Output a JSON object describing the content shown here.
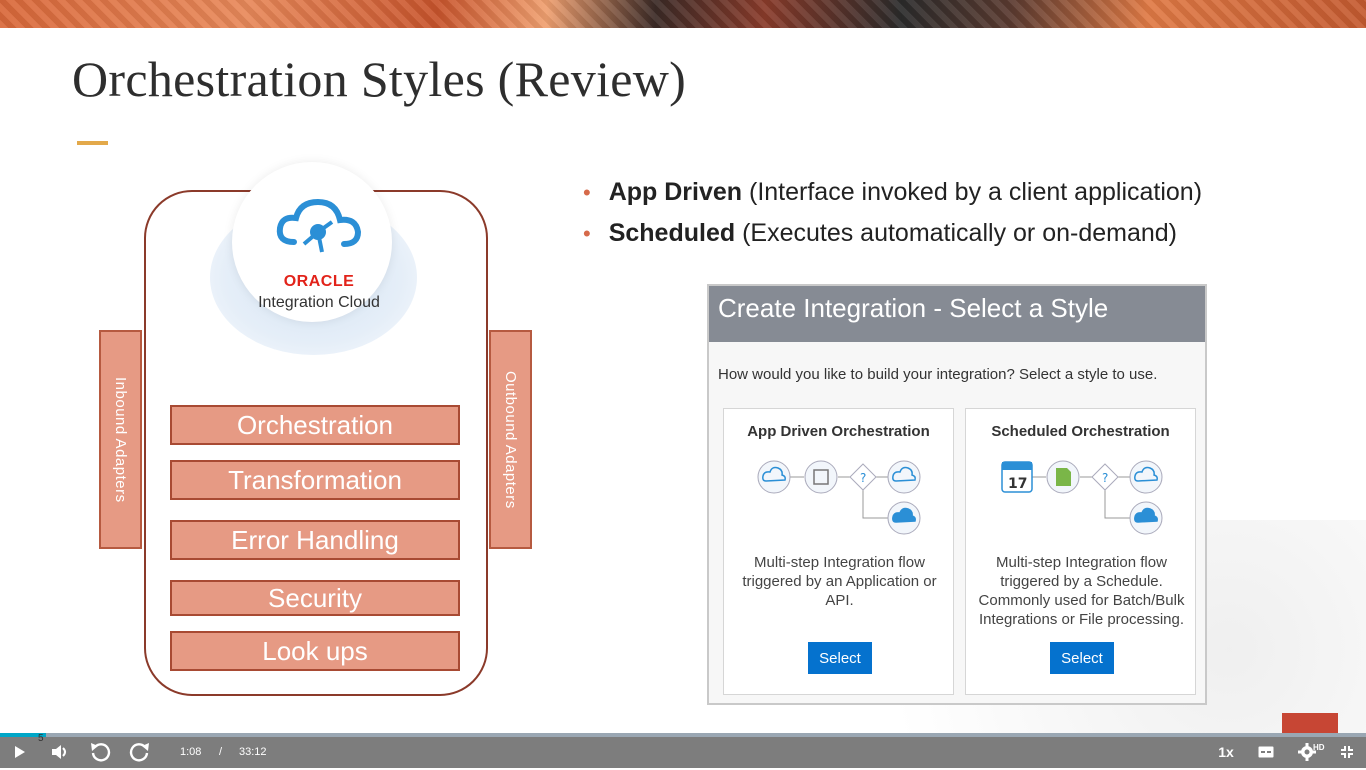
{
  "slide": {
    "title": "Orchestration Styles (Review)",
    "page_number": "5"
  },
  "diagram": {
    "brand": "ORACLE",
    "product": "Integration Cloud",
    "inbound_label": "Inbound Adapters",
    "outbound_label": "Outbound Adapters",
    "capabilities": [
      "Orchestration",
      "Transformation",
      "Error Handling",
      "Security",
      "Look ups"
    ]
  },
  "bullets": [
    {
      "bold": "App Driven",
      "text": " (Interface invoked by a client application)"
    },
    {
      "bold": "Scheduled",
      "text": " (Executes automatically or on-demand)"
    }
  ],
  "dialog": {
    "title": "Create Integration - Select a Style",
    "question": "How would you like to build your integration? Select a style to use.",
    "cards": [
      {
        "title": "App Driven Orchestration",
        "description": "Multi-step Integration flow triggered by an Application or API.",
        "button": "Select"
      },
      {
        "title": "Scheduled Orchestration",
        "description": "Multi-step Integration flow triggered by a Schedule. Commonly used for Batch/Bulk Integrations or File processing.",
        "button": "Select",
        "calendar_day": "17"
      }
    ]
  },
  "player": {
    "current_time": "1:08",
    "separator": "/",
    "duration": "33:12",
    "speed": "1x",
    "quality_badge": "HD",
    "progress": 0.034,
    "icons": [
      "play-icon",
      "volume-icon",
      "rewind-icon",
      "forward-icon",
      "captions-icon",
      "settings-icon",
      "fullscreen-exit-icon"
    ]
  },
  "colors": {
    "accent": "#e3a94a",
    "capability_fill": "#e69a84",
    "frame_border": "#8b3a2a",
    "oracle_red": "#e2231a",
    "select_button": "#0572ce",
    "dialog_header": "#868b94",
    "player_bar": "#7d7d7d"
  }
}
